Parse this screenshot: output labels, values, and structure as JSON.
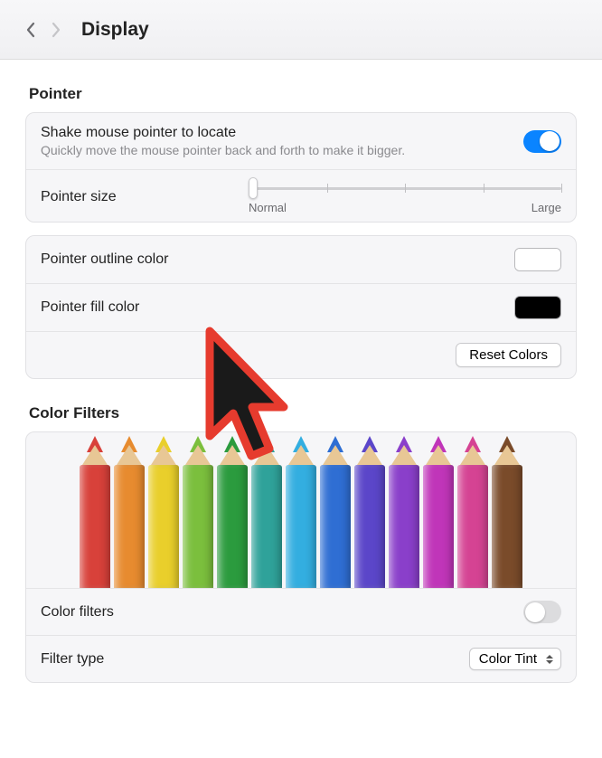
{
  "header": {
    "title": "Display"
  },
  "pointer": {
    "section_title": "Pointer",
    "shake": {
      "label": "Shake mouse pointer to locate",
      "sublabel": "Quickly move the mouse pointer back and forth to make it bigger.",
      "enabled": true
    },
    "size": {
      "label": "Pointer size",
      "min_label": "Normal",
      "max_label": "Large",
      "value": 0,
      "ticks": 5
    },
    "outline": {
      "label": "Pointer outline color",
      "color": "#ffffff"
    },
    "fill": {
      "label": "Pointer fill color",
      "color": "#000000"
    },
    "reset_label": "Reset Colors"
  },
  "color_filters": {
    "section_title": "Color Filters",
    "pencil_colors": [
      "#d8413a",
      "#e78b2f",
      "#e9cf2b",
      "#7bbf3d",
      "#2b9b3e",
      "#2fa29a",
      "#33aee0",
      "#2f6ed3",
      "#5b46c9",
      "#8a3fca",
      "#c035b9",
      "#d54393",
      "#7a4b2a"
    ],
    "enable": {
      "label": "Color filters",
      "enabled": false
    },
    "filter_type": {
      "label": "Filter type",
      "selected": "Color Tint"
    }
  }
}
